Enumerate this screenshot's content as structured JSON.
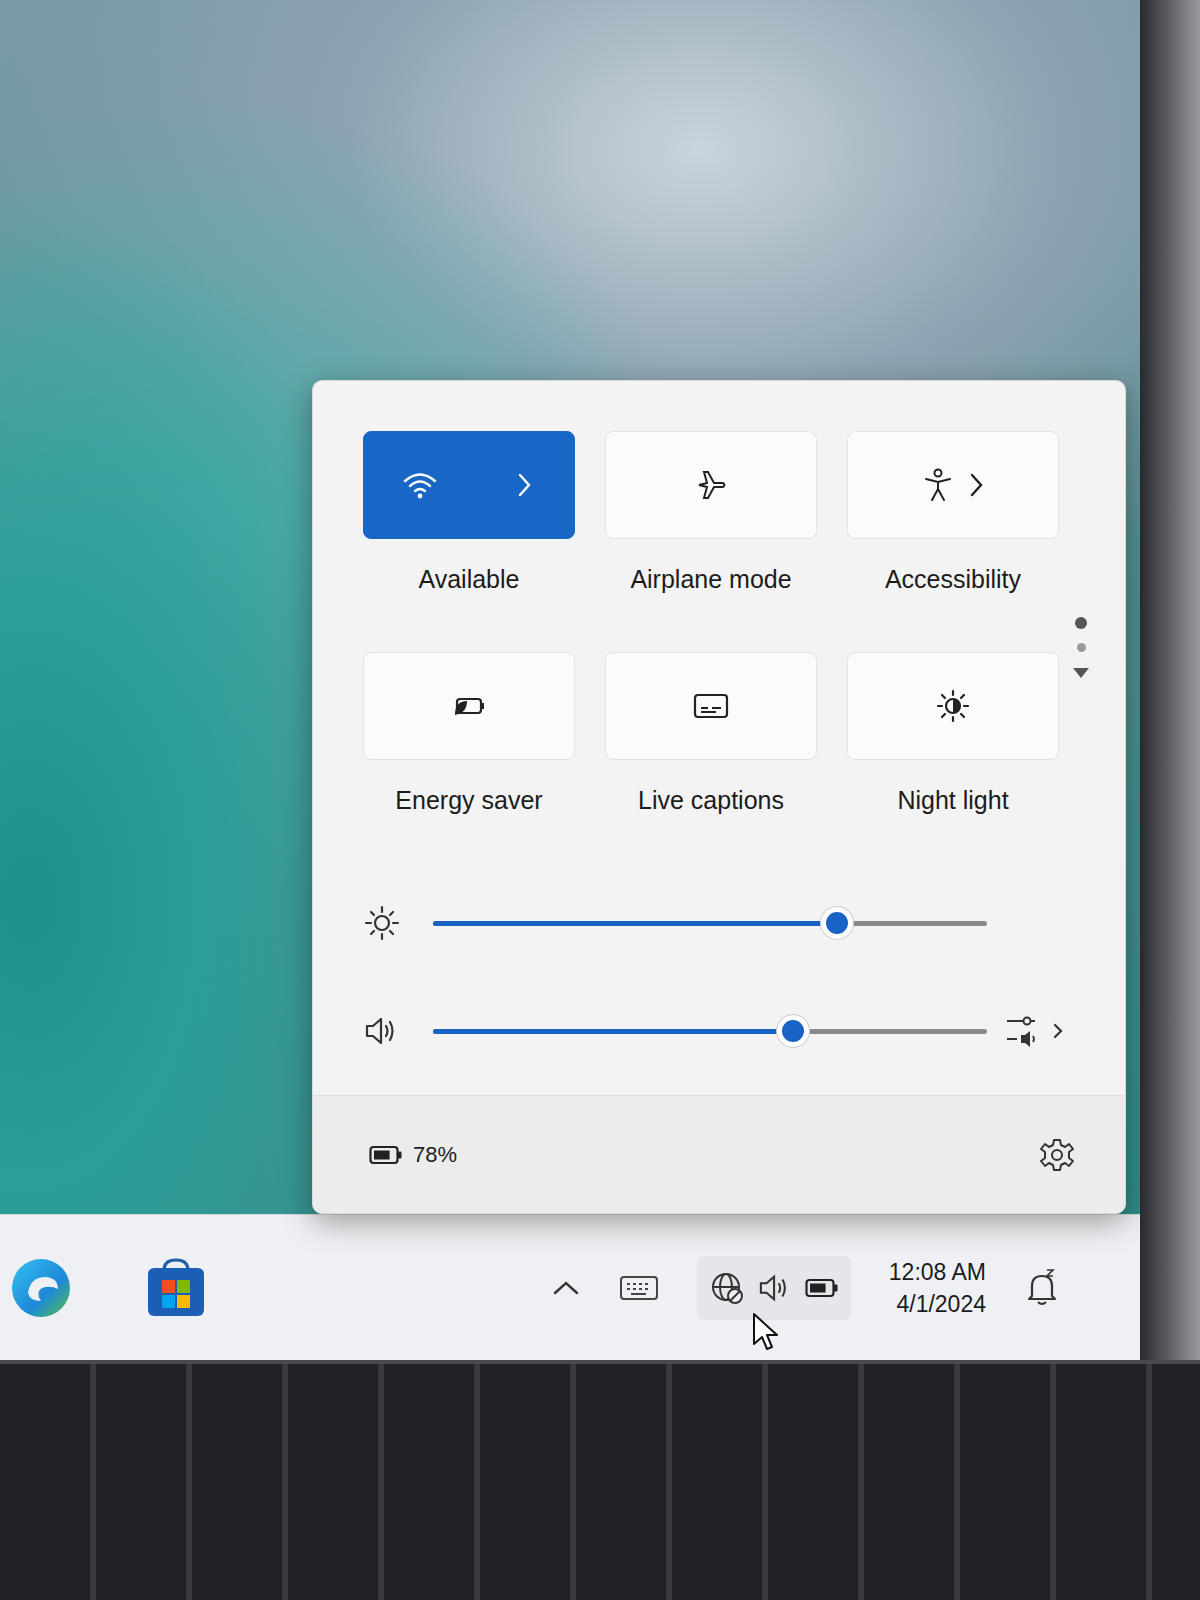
{
  "quick_settings": {
    "tiles": [
      {
        "label": "Available",
        "kind": "split",
        "on": true
      },
      {
        "label": "Airplane mode",
        "kind": "toggle",
        "on": false
      },
      {
        "label": "Accessibility",
        "kind": "split",
        "on": false
      },
      {
        "label": "Energy saver",
        "kind": "toggle",
        "on": false
      },
      {
        "label": "Live captions",
        "kind": "toggle",
        "on": false
      },
      {
        "label": "Night light",
        "kind": "toggle",
        "on": false
      }
    ],
    "pages": [
      {
        "selected": true
      },
      {
        "selected": false
      }
    ],
    "sliders": [
      {
        "kind": "brightness",
        "level": 0.73
      },
      {
        "kind": "volume",
        "level": 0.65
      }
    ],
    "battery": {
      "reading": "78%",
      "level": 0.78
    }
  },
  "taskbar": {
    "clock": {
      "time": "12:08 AM",
      "date": "4/1/2024"
    }
  }
}
